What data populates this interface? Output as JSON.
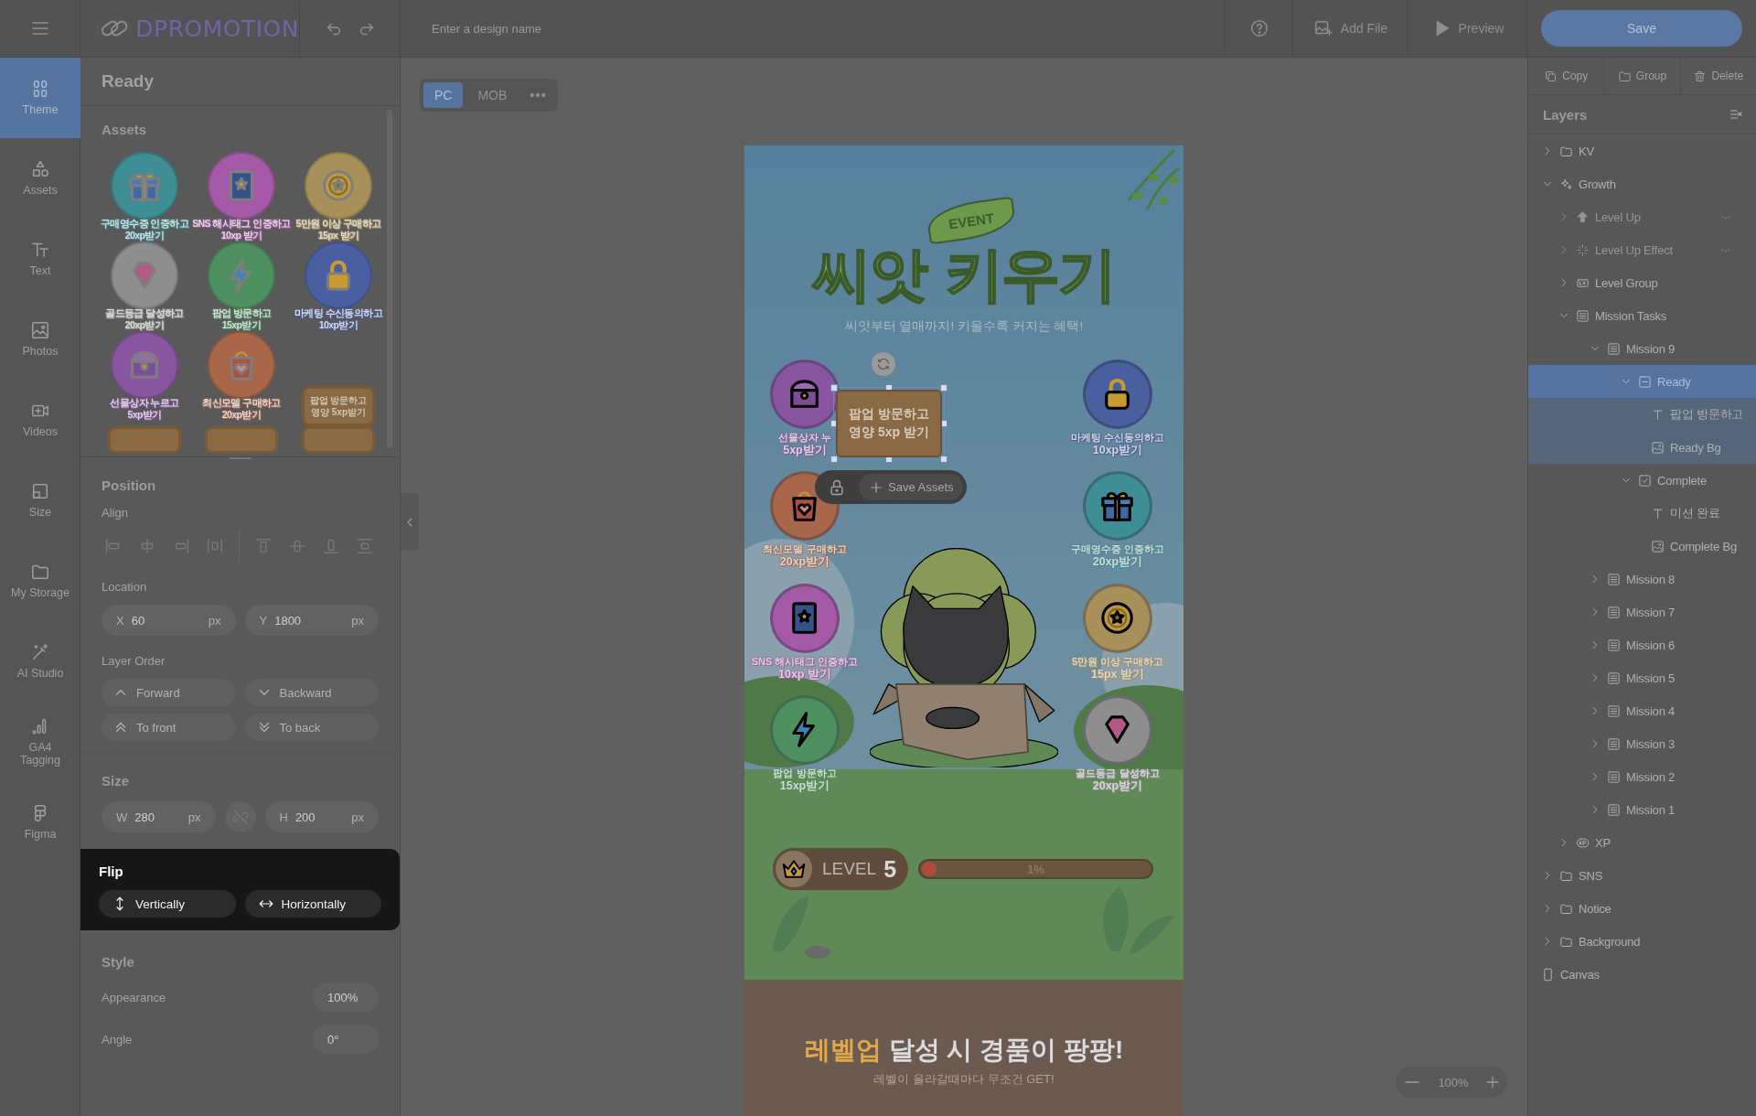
{
  "topbar": {
    "brand": "DPROMOTION",
    "design_name": {
      "placeholder": "Enter a design name"
    },
    "buttons": [
      {
        "label": "Add File",
        "kind": "add-file"
      },
      {
        "label": "Preview",
        "kind": "preview"
      }
    ],
    "save": "Save"
  },
  "nav": [
    {
      "label": "Theme",
      "kind": "theme",
      "selected": true
    },
    {
      "label": "Assets",
      "kind": "assets",
      "selected": false
    },
    {
      "label": "Text",
      "kind": "text",
      "selected": false
    },
    {
      "label": "Photos",
      "kind": "photos",
      "selected": false
    },
    {
      "label": "Videos",
      "kind": "videos",
      "selected": false
    },
    {
      "label": "Size",
      "kind": "size",
      "selected": false
    },
    {
      "label": "My Storage",
      "kind": "storage",
      "selected": false
    },
    {
      "label": "AI Studio",
      "kind": "ai",
      "selected": false
    },
    {
      "label": "GA4 Tagging",
      "kind": "ga4",
      "selected": false
    },
    {
      "label": "Figma",
      "kind": "figma",
      "selected": false
    }
  ],
  "panel": {
    "title": "Ready",
    "assets_title": "Assets",
    "assets": [
      {
        "kind": "gift",
        "color": "#3f8e95",
        "lines": [
          "구매영수증 인증하고",
          "20xp받기"
        ]
      },
      {
        "kind": "book",
        "color": "#a45aa6",
        "lines": [
          "SNS 해시태그 인증하고",
          "10xp 받기"
        ]
      },
      {
        "kind": "coin",
        "color": "#a8905a",
        "lines": [
          "5만원 이상 구매하고",
          "15px 받기"
        ]
      },
      {
        "kind": "gem",
        "color": "#8e8e8e",
        "lines": [
          "골드등급 달성하고",
          "20xp받기"
        ]
      },
      {
        "kind": "bolt",
        "color": "#4f9060",
        "lines": [
          "팝업 방문하고",
          "15xp받기"
        ]
      },
      {
        "kind": "lock",
        "color": "#4a5fa0",
        "lines": [
          "마케팅 수신동의하고",
          "10xp받기"
        ]
      },
      {
        "kind": "chest",
        "color": "#8a55a0",
        "lines": [
          "선물상자 누르고",
          "5xp받기"
        ]
      },
      {
        "kind": "bag",
        "color": "#a8664a",
        "lines": [
          "최신모델 구매하고",
          "20xp받기"
        ]
      },
      {
        "kind": "tag",
        "lines": [
          "팝업 방문하고",
          "영양 5xp받기"
        ]
      },
      {
        "kind": "tag"
      },
      {
        "kind": "tag"
      },
      {
        "kind": "tag"
      }
    ],
    "position": {
      "title": "Position",
      "align_label": "Align",
      "location_label": "Location",
      "location": [
        {
          "label": "X",
          "value": "60",
          "unit": "px"
        },
        {
          "label": "Y",
          "value": "1800",
          "unit": "px"
        }
      ],
      "order_label": "Layer Order",
      "order_buttons": [
        {
          "label": "Forward",
          "kind": "forward"
        },
        {
          "label": "Backward",
          "kind": "backward"
        },
        {
          "label": "To front",
          "kind": "front"
        },
        {
          "label": "To back",
          "kind": "back"
        }
      ]
    },
    "size": {
      "title": "Size",
      "fields": [
        {
          "label": "W",
          "value": "280",
          "unit": "px"
        },
        {
          "label": "H",
          "value": "200",
          "unit": "px"
        }
      ]
    },
    "flip": {
      "title": "Flip",
      "buttons": [
        {
          "label": "Vertically",
          "kind": "vertical"
        },
        {
          "label": "Horizontally",
          "kind": "horizontal"
        }
      ]
    },
    "style": {
      "title": "Style",
      "rows": [
        {
          "label": "Appearance",
          "value": "100%"
        },
        {
          "label": "Angle",
          "value": "0°"
        }
      ]
    }
  },
  "stage": {
    "tabs": [
      {
        "label": "PC",
        "selected": true
      },
      {
        "label": "MOB",
        "selected": false
      }
    ],
    "zoom": "100%",
    "design": {
      "event_tag": "EVENT",
      "title": "씨앗 키우기",
      "subtitle": "씨앗부터 열매까지! 키울수록 커지는 혜택!",
      "left_missions": [
        {
          "kind": "chest",
          "color": "#8a55a0",
          "lines": [
            "선물상자 누",
            "5xp받기"
          ]
        },
        {
          "kind": "bag",
          "color": "#a8664a",
          "lines": [
            "최신모델 구매하고",
            "20xp받기"
          ]
        },
        {
          "kind": "book",
          "color": "#a45aa6",
          "lines": [
            "SNS 해시태그 인증하고",
            "10xp 받기"
          ]
        },
        {
          "kind": "bolt",
          "color": "#4f9060",
          "lines": [
            "팝업 방문하고",
            "15xp받기"
          ]
        }
      ],
      "right_missions": [
        {
          "kind": "lock",
          "color": "#4a5fa0",
          "lines": [
            "마케팅 수신동의하고",
            "10xp받기"
          ]
        },
        {
          "kind": "gift",
          "color": "#3f8e95",
          "lines": [
            "구매영수증 인증하고",
            "20xp받기"
          ]
        },
        {
          "kind": "coin",
          "color": "#a8905a",
          "lines": [
            "5만원 이상 구매하고",
            "15px 받기"
          ]
        },
        {
          "kind": "gem",
          "color": "#8e8e8e",
          "lines": [
            "골드등급 달성하고",
            "20xp받기"
          ]
        }
      ],
      "selected_element": {
        "lines": [
          "팝업 방문하고",
          "영양 5xp 받기"
        ]
      },
      "save_assets": "Save Assets",
      "level": {
        "label": "LEVEL",
        "value": "5"
      },
      "progress": {
        "level": 0.01,
        "reading": "1%"
      },
      "headline": {
        "highlight": "레벨업",
        "rest": "달성 시 경품이 팡팡!"
      },
      "tagline": "레벨이 올라갈때마다 무조건 GET!"
    }
  },
  "layers": {
    "actions": [
      {
        "label": "Copy",
        "kind": "copy"
      },
      {
        "label": "Group",
        "kind": "group"
      },
      {
        "label": "Delete",
        "kind": "delete"
      }
    ],
    "title": "Layers",
    "tree": [
      {
        "label": "KV",
        "kind": "folder",
        "expanded": false,
        "hidden": false,
        "selected": false
      },
      {
        "label": "Growth",
        "kind": "sparkle",
        "expanded": true,
        "hidden": false,
        "selected": false,
        "children": [
          {
            "label": "Level Up",
            "kind": "arrow",
            "expanded": false,
            "hidden": true,
            "selected": false
          },
          {
            "label": "Level Up Effect",
            "kind": "spinner",
            "expanded": false,
            "hidden": true,
            "selected": false
          },
          {
            "label": "Level Group",
            "kind": "lv",
            "expanded": false,
            "hidden": false,
            "selected": false
          },
          {
            "label": "Mission Tasks",
            "kind": "list",
            "expanded": true,
            "hidden": false,
            "selected": false,
            "children": [
              {
                "label": "Mission 9",
                "kind": "list",
                "expanded": true,
                "hidden": false,
                "selected": false,
                "children": [
                  {
                    "label": "Ready",
                    "kind": "ready",
                    "expanded": true,
                    "hidden": false,
                    "selected": true,
                    "children": [
                      {
                        "label": "팝업 방문하고",
                        "kind": "text",
                        "hidden": false,
                        "selected": false
                      },
                      {
                        "label": "Ready Bg",
                        "kind": "image",
                        "hidden": false,
                        "selected": false
                      }
                    ]
                  },
                  {
                    "label": "Complete",
                    "kind": "check",
                    "expanded": true,
                    "hidden": false,
                    "selected": false,
                    "children": [
                      {
                        "label": "미션 완료",
                        "kind": "text",
                        "hidden": false,
                        "selected": false
                      },
                      {
                        "label": "Complete Bg",
                        "kind": "image",
                        "hidden": false,
                        "selected": false
                      }
                    ]
                  }
                ]
              },
              {
                "label": "Mission 8",
                "kind": "list",
                "expanded": false,
                "hidden": false,
                "selected": false
              },
              {
                "label": "Mission 7",
                "kind": "list",
                "expanded": false,
                "hidden": false,
                "selected": false
              },
              {
                "label": "Mission 6",
                "kind": "list",
                "expanded": false,
                "hidden": false,
                "selected": false
              },
              {
                "label": "Mission 5",
                "kind": "list",
                "expanded": false,
                "hidden": false,
                "selected": false
              },
              {
                "label": "Mission 4",
                "kind": "list",
                "expanded": false,
                "hidden": false,
                "selected": false
              },
              {
                "label": "Mission 3",
                "kind": "list",
                "expanded": false,
                "hidden": false,
                "selected": false
              },
              {
                "label": "Mission 2",
                "kind": "list",
                "expanded": false,
                "hidden": false,
                "selected": false
              },
              {
                "label": "Mission 1",
                "kind": "list",
                "expanded": false,
                "hidden": false,
                "selected": false
              }
            ]
          },
          {
            "label": "XP",
            "kind": "xp",
            "expanded": false,
            "hidden": false,
            "selected": false
          }
        ]
      },
      {
        "label": "SNS",
        "kind": "folder",
        "expanded": false,
        "hidden": false,
        "selected": false
      },
      {
        "label": "Notice",
        "kind": "folder",
        "expanded": false,
        "hidden": false,
        "selected": false
      },
      {
        "label": "Background",
        "kind": "folder",
        "expanded": false,
        "hidden": false,
        "selected": false
      },
      {
        "label": "Canvas",
        "kind": "canvas",
        "hidden": false,
        "selected": false
      }
    ]
  }
}
